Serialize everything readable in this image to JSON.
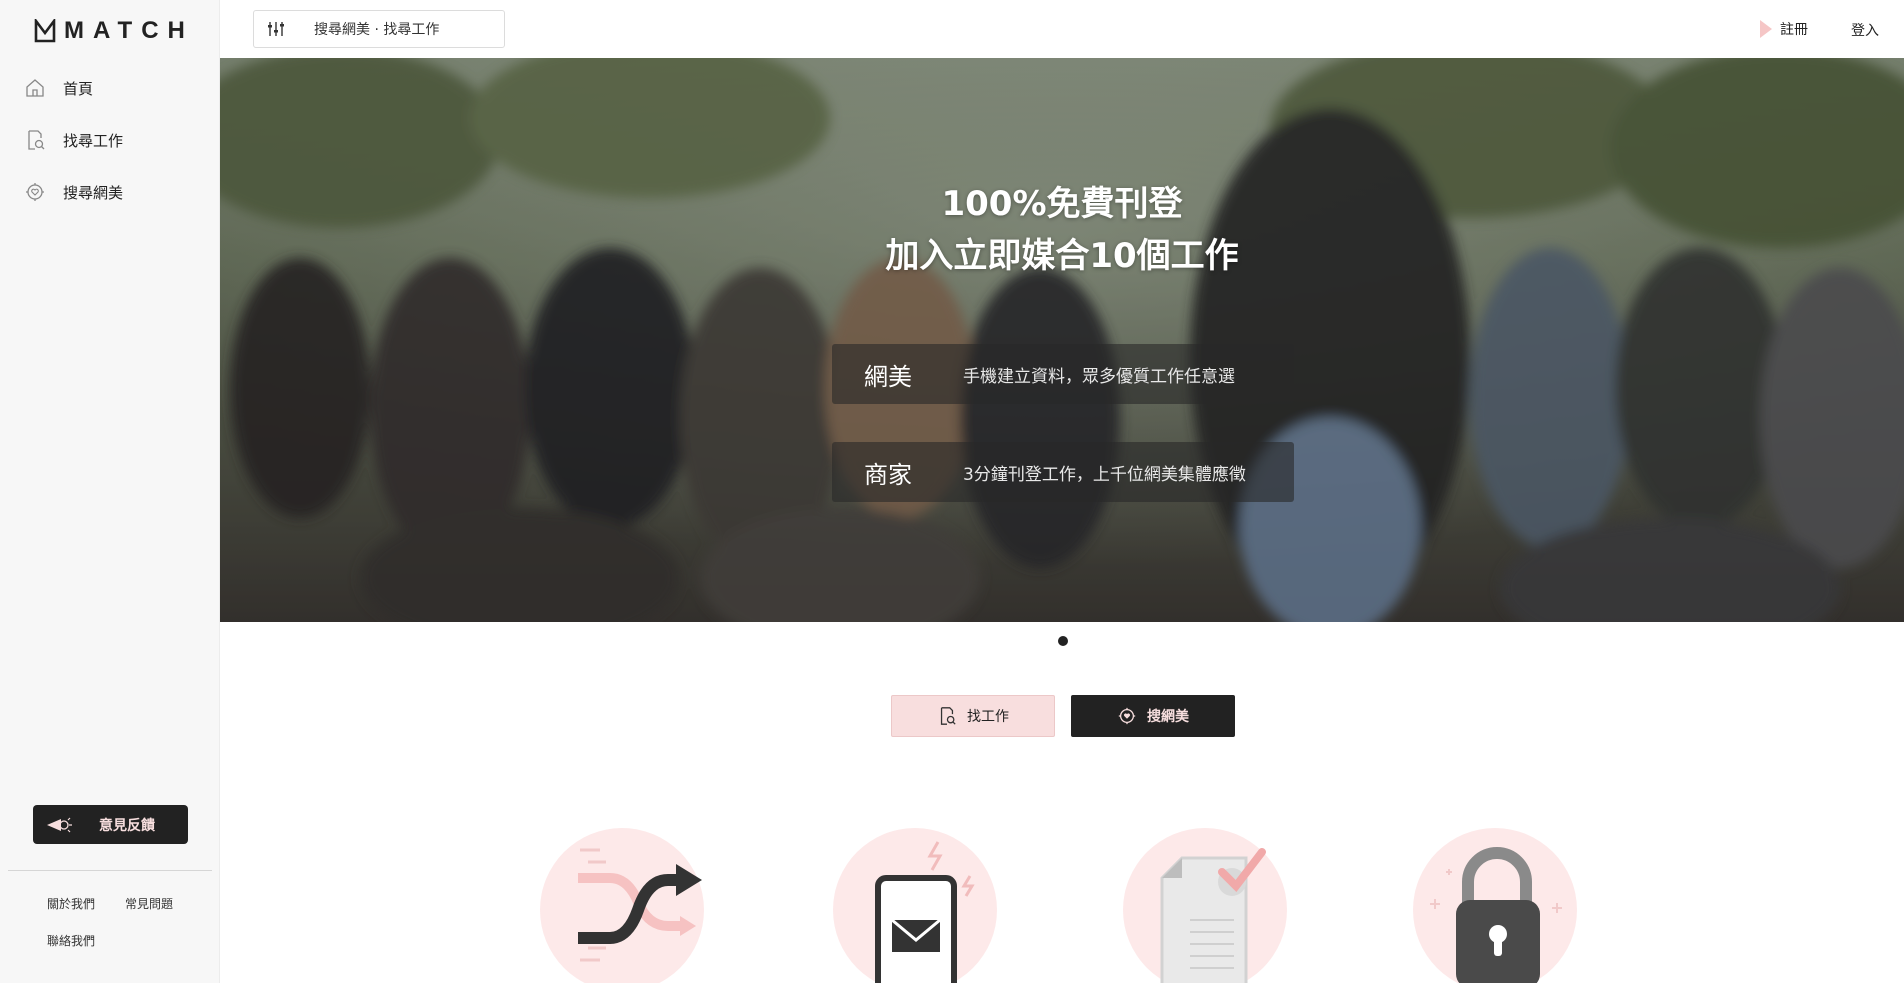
{
  "brand": {
    "name": "MATCH"
  },
  "sidebar": {
    "items": [
      {
        "label": "首頁",
        "icon": "home-icon"
      },
      {
        "label": "找尋工作",
        "icon": "find-job-icon"
      },
      {
        "label": "搜尋網美",
        "icon": "search-influencer-icon"
      }
    ],
    "feedback_label": "意見反饋",
    "footer_links": [
      "關於我們",
      "常見問題",
      "聯絡我們"
    ]
  },
  "header": {
    "search_label": "搜尋網美 · 找尋工作",
    "register_label": "註冊",
    "login_label": "登入"
  },
  "hero": {
    "title_line1": "100%免費刊登",
    "title_line2": "加入立即媒合10個工作",
    "cards": [
      {
        "key": "網美",
        "text": "手機建立資料，眾多優質工作任意選"
      },
      {
        "key": "商家",
        "text": "3分鐘刊登工作，上千位網美集體應徵"
      }
    ],
    "active_slide": 1,
    "slide_count": 1
  },
  "cta": {
    "find_label": "找工作",
    "search_label": "搜網美"
  },
  "features": [
    {
      "icon": "match-arrows-icon"
    },
    {
      "icon": "phone-mail-icon"
    },
    {
      "icon": "document-check-icon"
    },
    {
      "icon": "lock-icon"
    }
  ],
  "colors": {
    "accent_pink": "#f8dede",
    "dark": "#222222",
    "sidebar_bg": "#f7f7f7"
  }
}
